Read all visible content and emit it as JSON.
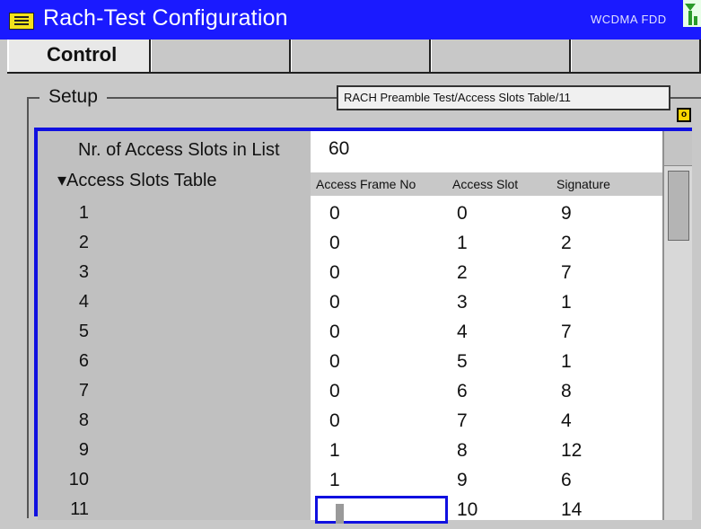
{
  "window": {
    "title": "Rach-Test Configuration",
    "status_text": "WCDMA FDD",
    "menu_icon": "menu-icon",
    "antenna_icon": "antenna-icon"
  },
  "tabs": [
    {
      "label": "Control",
      "active": true
    },
    {
      "label": "",
      "active": false
    },
    {
      "label": "",
      "active": false
    },
    {
      "label": "",
      "active": false
    },
    {
      "label": "",
      "active": false
    }
  ],
  "setup": {
    "group_label": "Setup",
    "path": "RACH Preamble Test/Access Slots Table/11",
    "marker": "o"
  },
  "params": {
    "nr_label": "Nr. of Access Slots in List",
    "nr_value": "60",
    "table_label": "▾Access Slots Table"
  },
  "table": {
    "headers": [
      "Access Frame No",
      "Access Slot",
      "Signature"
    ],
    "rows": [
      {
        "n": "1",
        "frame": "0",
        "slot": "0",
        "sig": "9"
      },
      {
        "n": "2",
        "frame": "0",
        "slot": "1",
        "sig": "2"
      },
      {
        "n": "3",
        "frame": "0",
        "slot": "2",
        "sig": "7"
      },
      {
        "n": "4",
        "frame": "0",
        "slot": "3",
        "sig": "1"
      },
      {
        "n": "5",
        "frame": "0",
        "slot": "4",
        "sig": "7"
      },
      {
        "n": "6",
        "frame": "0",
        "slot": "5",
        "sig": "1"
      },
      {
        "n": "7",
        "frame": "0",
        "slot": "6",
        "sig": "8"
      },
      {
        "n": "8",
        "frame": "0",
        "slot": "7",
        "sig": "4"
      },
      {
        "n": "9",
        "frame": "1",
        "slot": "8",
        "sig": "12"
      },
      {
        "n": "10",
        "frame": "1",
        "slot": "9",
        "sig": "6"
      },
      {
        "n": "11",
        "frame": "",
        "slot": "10",
        "sig": "14"
      }
    ]
  },
  "colors": {
    "title_bar": "#1a1aff",
    "panel_border": "#1010e0",
    "background": "#c8c8c8",
    "marker": "#ffd500"
  }
}
